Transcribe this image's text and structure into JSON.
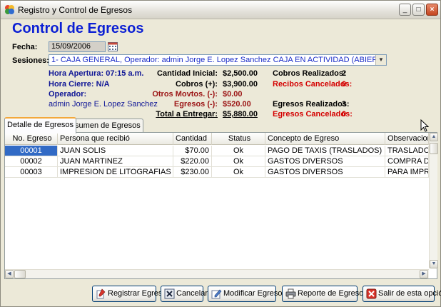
{
  "window": {
    "title": "Registro y Control de Egresos",
    "minimize": "_",
    "maximize": "□",
    "close": "×"
  },
  "heading": "Control de Egresos",
  "form": {
    "fecha_label": "Fecha:",
    "fecha_value": "15/09/2006",
    "sesiones_label": "Sesiones:",
    "sesiones_value": "1- CAJA GENERAL, Operador: admin Jorge E. Lopez Sanchez   CAJA EN ACTIVIDAD (ABIERTA)"
  },
  "summary": {
    "hora_apertura": "Hora Apertura: 07:15 a.m.",
    "hora_cierre": "Hora Cierre: N/A",
    "operador_label": "Operador:",
    "operador_value": "admin Jorge E. Lopez Sanchez",
    "cantidad_inicial_label": "Cantidad Inicial:",
    "cantidad_inicial_value": "$2,500.00",
    "cobros_label": "Cobros (+):",
    "cobros_value": "$3,900.00",
    "otros_label": "Otros Movtos. (-):",
    "otros_value": "$0.00",
    "egresos_label": "Egresos (-):",
    "egresos_value": "$520.00",
    "total_label": "Total a Entregar:",
    "total_value": "$5,880.00",
    "cobros_realizados_label": "Cobros Realizados:",
    "cobros_realizados_value": "2",
    "recibos_cancelados_label": "Recibos Cancelados:",
    "recibos_cancelados_value": "0",
    "egresos_realizados_label": "Egresos Realizados:",
    "egresos_realizados_value": "3",
    "egresos_cancelados_label": "Egresos Cancelados:",
    "egresos_cancelados_value": "0"
  },
  "tabs": [
    {
      "label": "Detalle de Egresos"
    },
    {
      "label": "Resumen de Egresos"
    }
  ],
  "table": {
    "headers": [
      "No. Egreso",
      "Persona que recibió",
      "Cantidad",
      "Status",
      "Concepto de Egreso",
      "Observaciones"
    ],
    "rows": [
      [
        "00001",
        "JUAN SOLIS",
        "$70.00",
        "Ok",
        "PAGO DE TAXIS (TRASLADOS)",
        "TRASLADO DE"
      ],
      [
        "00002",
        "JUAN MARTINEZ",
        "$220.00",
        "Ok",
        "GASTOS DIVERSOS",
        "COMPRA DE GA"
      ],
      [
        "00003",
        "IMPRESION DE LITOGRAFIAS",
        "$230.00",
        "Ok",
        "GASTOS DIVERSOS",
        "PARA IMPRIMI"
      ]
    ]
  },
  "buttons": {
    "registrar": "Registrar Egreso",
    "cancelar": "Cancelar",
    "modificar": "Modificar Egreso",
    "reporte": "Reporte de Egresos",
    "salir": "Salir de esta opción"
  },
  "colors": {
    "heading": "#0b1fd4",
    "accent_red": "#d40000",
    "selection": "#316ac5"
  }
}
